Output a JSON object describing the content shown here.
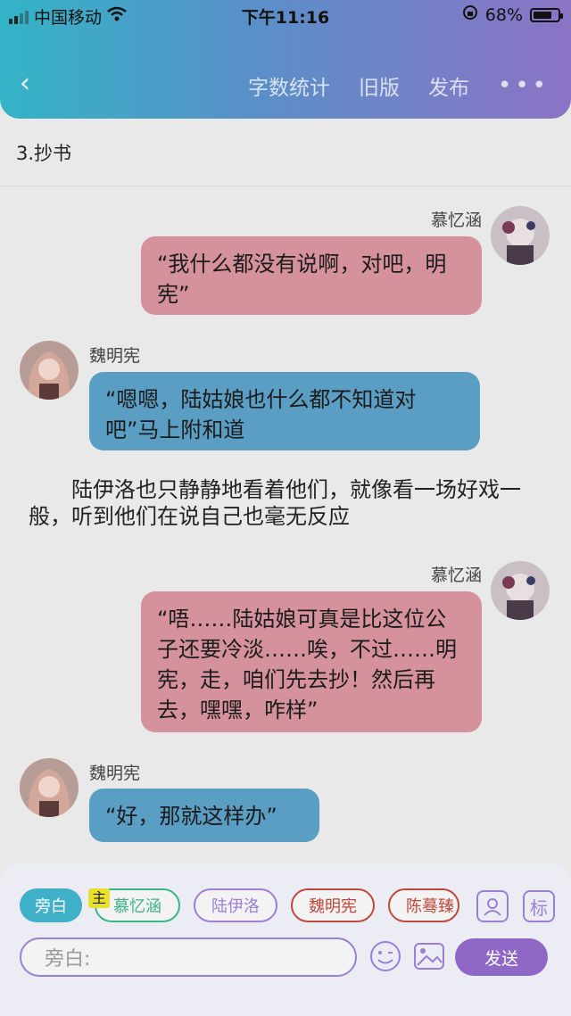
{
  "status": {
    "carrier": "中国移动",
    "time": "下午11:16",
    "battery": "68%"
  },
  "nav": {
    "back": "‹",
    "word_count": "字数统计",
    "old_version": "旧版",
    "publish": "发布",
    "more": "•••"
  },
  "chapter_title": "3.抄书",
  "messages": [
    {
      "speaker": "慕忆涵",
      "text": "“我什么都没有说啊，对吧，明宪”"
    },
    {
      "speaker": "魏明宪",
      "text": "“嗯嗯，陆姑娘也什么都不知道对吧”马上附和道"
    },
    {
      "narration": "陆伊洛也只静静地看着他们，就像看一场好戏一般，听到他们在说自己也毫无反应"
    },
    {
      "speaker": "慕忆涵",
      "text": "“唔……陆姑娘可真是比这位公子还要冷淡……唉，不过……明宪，走，咱们先去抄！然后再去，嘿嘿，咋样”"
    },
    {
      "speaker": "魏明宪",
      "text": "“好，那就这样办”"
    }
  ],
  "composer": {
    "roles": [
      "旁白",
      "慕忆涵",
      "陆伊洛",
      "魏明宪",
      "陈蓦臻"
    ],
    "main_tag": "主",
    "tag_button": "标",
    "placeholder": "旁白:",
    "send": "发送"
  }
}
